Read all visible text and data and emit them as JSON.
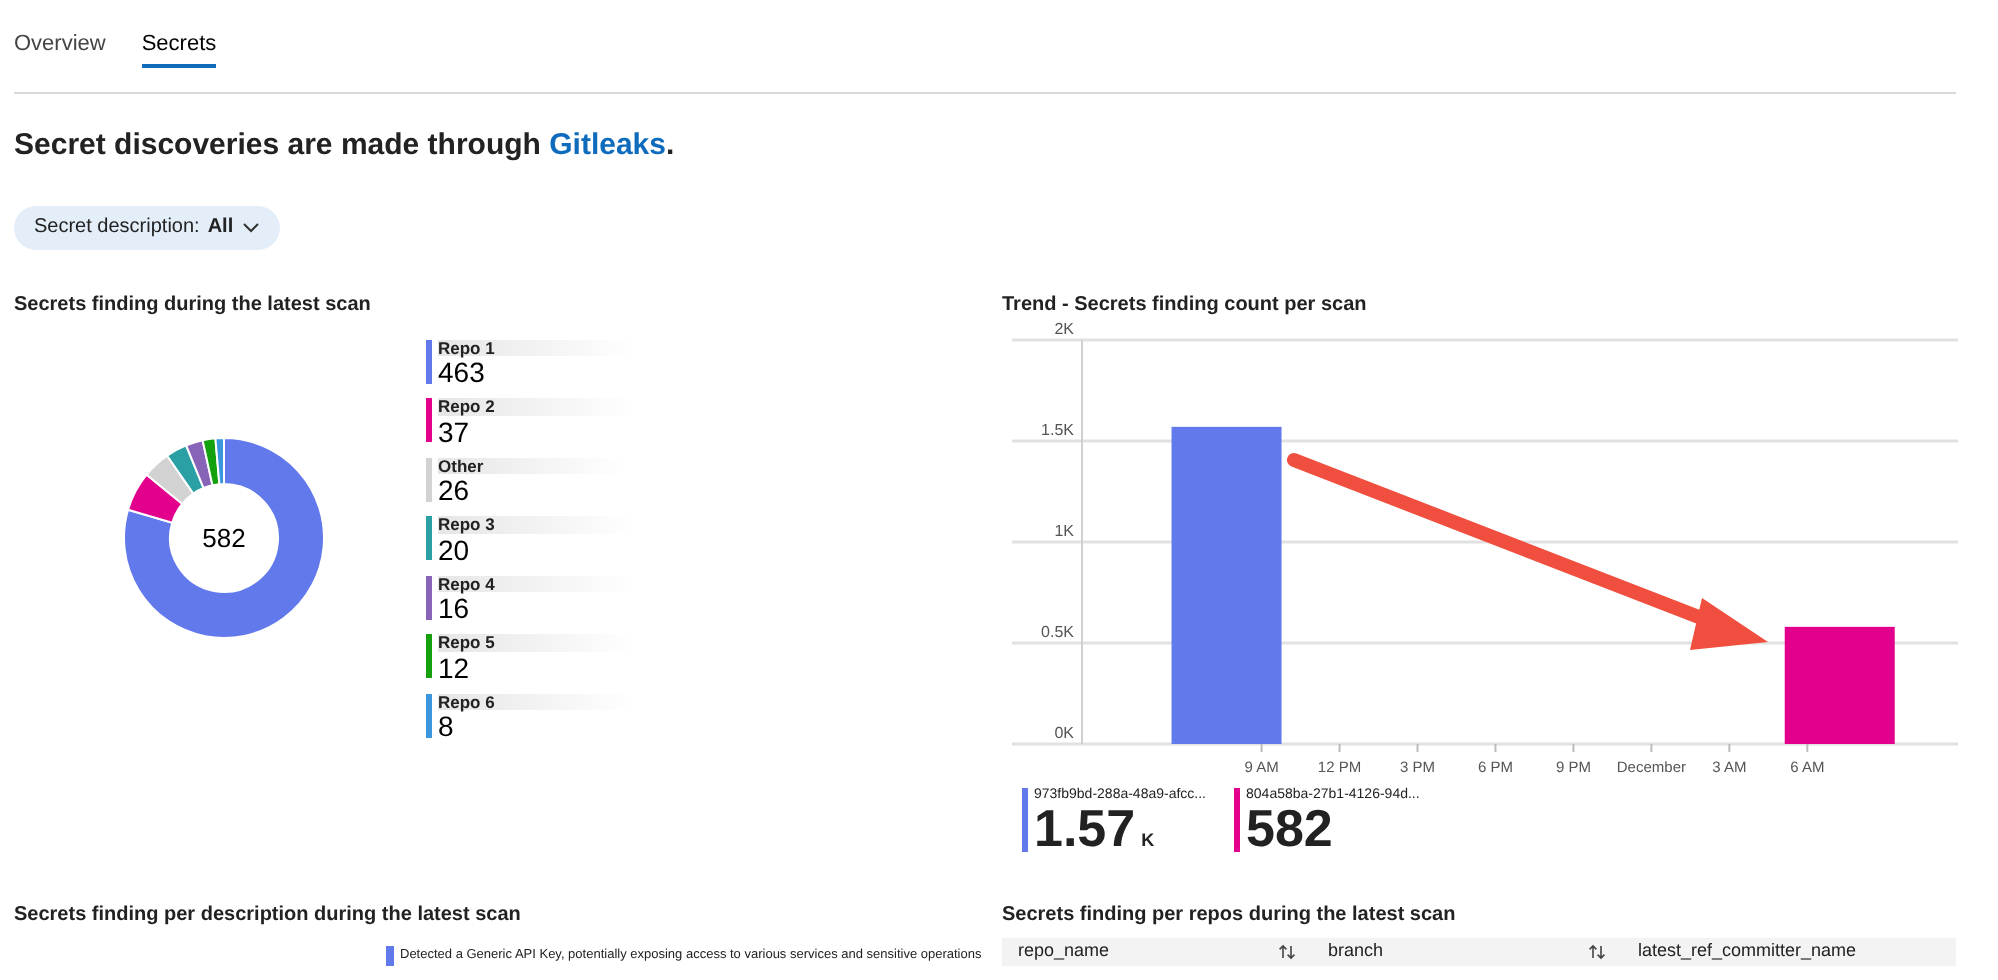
{
  "tabs": [
    {
      "label": "Overview",
      "selected": false
    },
    {
      "label": "Secrets",
      "selected": true
    }
  ],
  "intro": {
    "text": "Secret discoveries are made through ",
    "link": "Gitleaks",
    "end": "."
  },
  "filter": {
    "label": "Secret description:",
    "value": "All"
  },
  "latest_scan": {
    "title": "Secrets finding during the latest scan",
    "total": "582",
    "legend": [
      {
        "value": "463",
        "color": "#6279ec"
      },
      {
        "value": "37",
        "color": "#e3008c"
      },
      {
        "value": "26",
        "color": "#d2d2d2"
      },
      {
        "value": "20",
        "color": "#2aa0a4"
      },
      {
        "value": "16",
        "color": "#8764b8"
      },
      {
        "value": "12",
        "color": "#13a10e"
      },
      {
        "value": "8",
        "color": "#3a96dd"
      }
    ],
    "chart_data": {
      "type": "donut",
      "categories": [
        "Repo 1",
        "Repo 2",
        "Other",
        "Repo 3",
        "Repo 4",
        "Repo 5",
        "Repo 6"
      ],
      "values": [
        79.55,
        6.36,
        4.47,
        3.44,
        2.75,
        2.06,
        1.37
      ]
    }
  },
  "trend": {
    "title": "Trend - Secrets finding count per scan",
    "chart_data": {
      "type": "bar",
      "grid": true,
      "ylim": [
        0,
        2000
      ],
      "series": [
        {
          "name": "973fb9bd-288a-48a9-afcc...",
          "color": "#6279ec",
          "values": [
            1570,
            null
          ]
        },
        {
          "name": "804a58ba-27b1-4126-94d...",
          "color": "#e3008c",
          "values": [
            null,
            580
          ]
        }
      ],
      "yticks": [
        {
          "value": 0,
          "label": "0K"
        },
        {
          "value": 500,
          "label": "0.5K"
        },
        {
          "value": 1000,
          "label": "1K"
        },
        {
          "value": 1500,
          "label": "1.5K"
        },
        {
          "value": 2000,
          "label": "2K"
        }
      ]
    },
    "time_labels": [
      "9 AM",
      "12 PM",
      "3 PM",
      "6 PM",
      "9 PM",
      "December",
      "3 AM",
      "6 AM"
    ],
    "legend": [
      {
        "value": "1.57",
        "unit": "K"
      },
      {
        "value": "582"
      }
    ]
  },
  "per_description": {
    "title": "Secrets finding per description during the latest scan",
    "legend": [
      {
        "label": "Detected a Generic API Key, potentially exposing access to various services and sensitive operations",
        "color": "#6279ec"
      }
    ]
  },
  "per_repos": {
    "title": "Secrets finding per repos during the latest scan",
    "columns": [
      {
        "label": "repo_name",
        "sortable": true
      },
      {
        "label": "branch",
        "sortable": true
      },
      {
        "label": "latest_ref_committer_name",
        "sortable": false
      }
    ]
  }
}
